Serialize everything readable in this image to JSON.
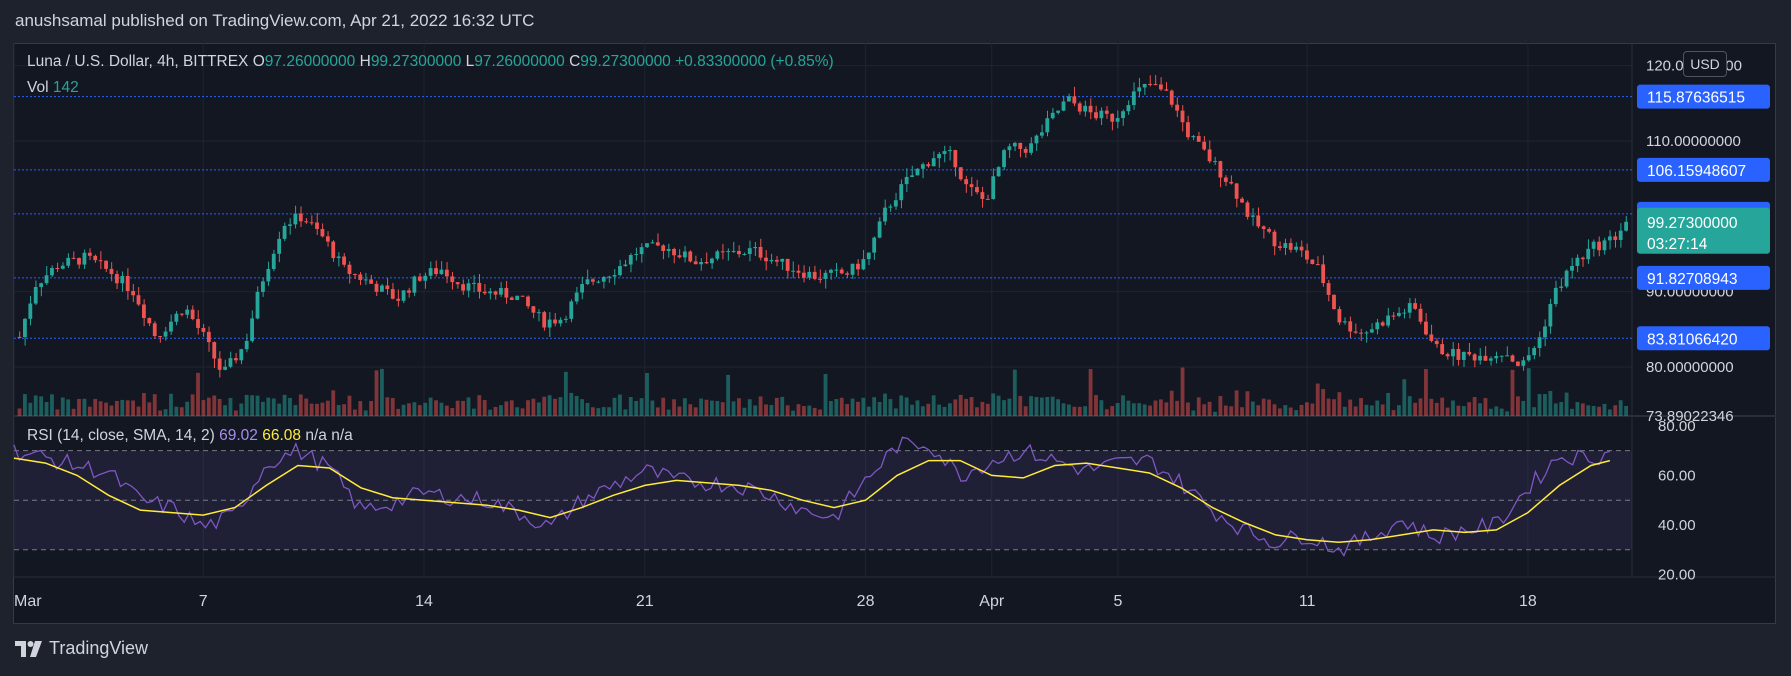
{
  "publisher_line": "anushsamal published on TradingView.com, Apr 21, 2022 16:32 UTC",
  "header": {
    "symbol": "Luna / U.S. Dollar, 4h, BITTREX",
    "o_label": "O",
    "o_value": "97.26000000",
    "h_label": "H",
    "h_value": "99.27300000",
    "l_label": "L",
    "l_value": "97.26000000",
    "c_label": "C",
    "c_value": "99.27300000",
    "change": "+0.83300000 (+0.85%)"
  },
  "volume": {
    "label": "Vol",
    "value": "142"
  },
  "rsi": {
    "label": "RSI (14, close, SMA, 14, 2)",
    "value": "69.02",
    "sma": "66.08",
    "na1": "n/a",
    "na2": "n/a"
  },
  "currency_button": "USD",
  "brand": {
    "name": "TradingView",
    "logo_icon": "tradingview-logo-icon"
  },
  "colors": {
    "up": "#26a69a",
    "down": "#ef5350",
    "rsi_line": "#7e57c2",
    "rsi_sma": "#ffeb3b",
    "level_line": "#2962ff",
    "price_tag": "#26a69a"
  },
  "chart_data": [
    {
      "type": "candlestick",
      "title": "Luna / U.S. Dollar, 4h, BITTREX",
      "ylim": [
        73.5,
        123
      ],
      "y_ticks": [
        {
          "value": 120,
          "label": "120.00000000"
        },
        {
          "value": 110,
          "label": "110.00000000"
        },
        {
          "value": 90,
          "label": "90.00000000"
        },
        {
          "value": 80,
          "label": "80.00000000"
        },
        {
          "value": 73.5,
          "label": "73.89022346"
        }
      ],
      "x_ticks": [
        {
          "day": 0,
          "label": "Mar"
        },
        {
          "day": 6,
          "label": "7"
        },
        {
          "day": 13,
          "label": "14"
        },
        {
          "day": 20,
          "label": "21"
        },
        {
          "day": 27,
          "label": "28"
        },
        {
          "day": 31,
          "label": "Apr"
        },
        {
          "day": 35,
          "label": "5"
        },
        {
          "day": 41,
          "label": "11"
        },
        {
          "day": 48,
          "label": "18"
        }
      ],
      "horizontal_levels": [
        {
          "value": 115.87636515,
          "label": "115.87636515"
        },
        {
          "value": 106.15948607,
          "label": "106.15948607"
        },
        {
          "value": 100.32935862,
          "label": "100.32935862"
        },
        {
          "value": 91.82708943,
          "label": "91.82708943"
        },
        {
          "value": 83.8106642,
          "label": "83.81066420"
        }
      ],
      "last_price": {
        "value": 99.273,
        "label": "99.27300000",
        "countdown": "03:27:14"
      },
      "price_path": [
        [
          0,
          84
        ],
        [
          0.5,
          91
        ],
        [
          1.2,
          93.5
        ],
        [
          2.1,
          94.5
        ],
        [
          2.9,
          92.5
        ],
        [
          3.6,
          90
        ],
        [
          4.3,
          84
        ],
        [
          5.2,
          88
        ],
        [
          5.8,
          84
        ],
        [
          6.4,
          79
        ],
        [
          7.1,
          83
        ],
        [
          7.6,
          91
        ],
        [
          8.3,
          99
        ],
        [
          8.9,
          100
        ],
        [
          9.6,
          97
        ],
        [
          10.2,
          93
        ],
        [
          10.9,
          91.5
        ],
        [
          11.9,
          89
        ],
        [
          12.6,
          92
        ],
        [
          13.3,
          93
        ],
        [
          13.9,
          91
        ],
        [
          14.6,
          90
        ],
        [
          15.6,
          89.5
        ],
        [
          16.5,
          86
        ],
        [
          17.1,
          86.5
        ],
        [
          17.8,
          91
        ],
        [
          18.8,
          93
        ],
        [
          19.5,
          95.5
        ],
        [
          20.3,
          96
        ],
        [
          21.3,
          94
        ],
        [
          22.3,
          95
        ],
        [
          23.1,
          95.5
        ],
        [
          24.1,
          93.5
        ],
        [
          25.1,
          92
        ],
        [
          26.1,
          92.5
        ],
        [
          26.7,
          94.5
        ],
        [
          27.3,
          101
        ],
        [
          28.0,
          105
        ],
        [
          28.8,
          108
        ],
        [
          29.4,
          108
        ],
        [
          29.8,
          104
        ],
        [
          30.4,
          102
        ],
        [
          31.1,
          109
        ],
        [
          31.8,
          109
        ],
        [
          32.4,
          112.5
        ],
        [
          33.0,
          115.5
        ],
        [
          33.8,
          113.5
        ],
        [
          34.5,
          113
        ],
        [
          35.0,
          116
        ],
        [
          35.6,
          117.5
        ],
        [
          36.2,
          116
        ],
        [
          36.8,
          111
        ],
        [
          37.6,
          107
        ],
        [
          38.2,
          104
        ],
        [
          38.8,
          99.5
        ],
        [
          39.6,
          96.5
        ],
        [
          40.3,
          95.5
        ],
        [
          40.9,
          93
        ],
        [
          41.6,
          86
        ],
        [
          42.3,
          84.5
        ],
        [
          43.1,
          86.5
        ],
        [
          43.9,
          88
        ],
        [
          44.6,
          82.5
        ],
        [
          45.3,
          81.5
        ],
        [
          46.0,
          81.5
        ],
        [
          46.8,
          82
        ],
        [
          47.3,
          80
        ],
        [
          47.9,
          84
        ],
        [
          48.3,
          89.5
        ],
        [
          48.9,
          93.5
        ],
        [
          49.6,
          96
        ],
        [
          50.2,
          97
        ],
        [
          50.6,
          99.3
        ]
      ]
    },
    {
      "type": "line",
      "title": "RSI (14, close, SMA, 14, 2)",
      "ylim": [
        19,
        84
      ],
      "y_ticks": [
        {
          "value": 80,
          "label": "80.00"
        },
        {
          "value": 60,
          "label": "60.00"
        },
        {
          "value": 40,
          "label": "40.00"
        },
        {
          "value": 20,
          "label": "20.00"
        }
      ],
      "bands": {
        "upper": 70,
        "middle": 50,
        "lower": 30
      },
      "series": [
        {
          "name": "RSI",
          "points": [
            [
              0,
              70
            ],
            [
              1,
              67
            ],
            [
              2,
              64
            ],
            [
              3,
              61
            ],
            [
              4,
              50
            ],
            [
              5,
              47
            ],
            [
              6,
              39
            ],
            [
              7,
              44
            ],
            [
              8,
              65
            ],
            [
              9,
              70
            ],
            [
              10,
              63
            ],
            [
              11,
              46
            ],
            [
              12,
              49
            ],
            [
              13,
              53
            ],
            [
              14,
              51
            ],
            [
              15,
              50
            ],
            [
              16,
              45
            ],
            [
              17,
              39
            ],
            [
              18,
              50
            ],
            [
              19,
              56
            ],
            [
              20,
              62
            ],
            [
              21,
              58
            ],
            [
              22,
              57
            ],
            [
              23,
              56
            ],
            [
              24,
              52
            ],
            [
              25,
              46
            ],
            [
              26,
              43
            ],
            [
              27,
              58
            ],
            [
              28,
              72
            ],
            [
              29,
              73
            ],
            [
              30,
              60
            ],
            [
              31,
              66
            ],
            [
              32,
              70
            ],
            [
              33,
              66
            ],
            [
              34,
              62
            ],
            [
              35,
              65
            ],
            [
              36,
              66
            ],
            [
              37,
              57
            ],
            [
              38,
              46
            ],
            [
              39,
              38
            ],
            [
              40,
              33
            ],
            [
              41,
              36
            ],
            [
              42,
              30
            ],
            [
              43,
              35
            ],
            [
              44,
              42
            ],
            [
              45,
              35
            ],
            [
              46,
              38
            ],
            [
              47,
              40
            ],
            [
              48,
              55
            ],
            [
              49,
              68
            ],
            [
              50,
              67
            ],
            [
              50.6,
              69
            ]
          ]
        },
        {
          "name": "RSI-based MA",
          "points": [
            [
              0,
              67
            ],
            [
              1,
              65
            ],
            [
              2,
              60
            ],
            [
              3,
              52
            ],
            [
              4,
              46
            ],
            [
              5,
              45
            ],
            [
              6,
              44
            ],
            [
              7,
              47
            ],
            [
              8,
              56
            ],
            [
              9,
              64
            ],
            [
              10,
              63
            ],
            [
              11,
              55
            ],
            [
              12,
              51
            ],
            [
              13,
              50
            ],
            [
              14,
              49
            ],
            [
              15,
              48
            ],
            [
              16,
              46
            ],
            [
              17,
              43
            ],
            [
              18,
              47
            ],
            [
              19,
              52
            ],
            [
              20,
              56
            ],
            [
              21,
              58
            ],
            [
              22,
              57
            ],
            [
              23,
              56
            ],
            [
              24,
              54
            ],
            [
              25,
              50
            ],
            [
              26,
              47
            ],
            [
              27,
              50
            ],
            [
              28,
              60
            ],
            [
              29,
              66
            ],
            [
              30,
              66
            ],
            [
              31,
              60
            ],
            [
              32,
              59
            ],
            [
              33,
              64
            ],
            [
              34,
              65
            ],
            [
              35,
              63
            ],
            [
              36,
              61
            ],
            [
              37,
              55
            ],
            [
              38,
              47
            ],
            [
              39,
              41
            ],
            [
              40,
              36
            ],
            [
              41,
              34
            ],
            [
              42,
              33
            ],
            [
              43,
              34
            ],
            [
              44,
              36
            ],
            [
              45,
              38
            ],
            [
              46,
              37
            ],
            [
              47,
              38
            ],
            [
              48,
              45
            ],
            [
              49,
              56
            ],
            [
              50,
              64
            ],
            [
              50.6,
              66
            ]
          ]
        }
      ]
    }
  ]
}
